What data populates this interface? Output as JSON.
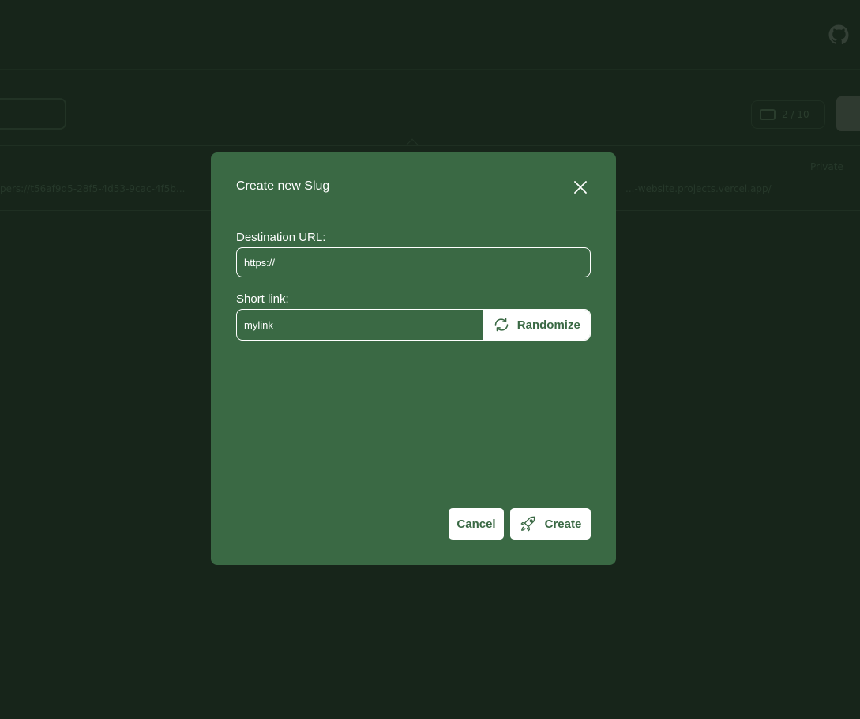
{
  "background": {
    "pager_text": "2 / 10",
    "row_text_left": "pers://t56af9d5-28f5-4d53-9cac-4f5b...",
    "row_text_right": "...-website.projects.vercel.app/",
    "row_badge": "Private"
  },
  "modal": {
    "title": "Create new Slug",
    "close_icon": "close-icon",
    "destination": {
      "label": "Destination URL:",
      "value": "https://"
    },
    "short_link": {
      "label": "Short link:",
      "value": "mylink",
      "randomize_label": "Randomize",
      "randomize_icon": "refresh-icon"
    },
    "actions": {
      "cancel_label": "Cancel",
      "create_label": "Create",
      "create_icon": "rocket-icon"
    }
  },
  "colors": {
    "page_background": "#17251a",
    "modal_background": "#3a6944",
    "button_background": "#ffffff",
    "button_text": "#3a6944"
  }
}
